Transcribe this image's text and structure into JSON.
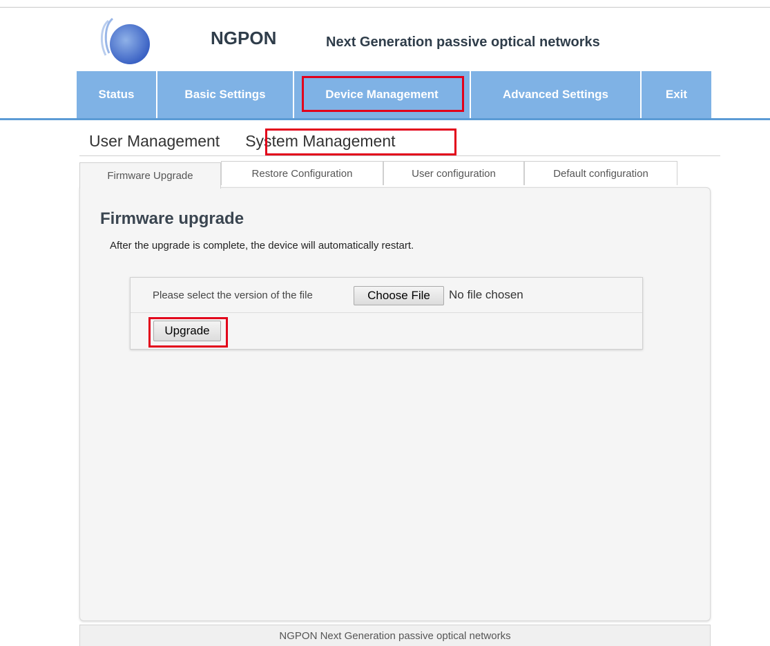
{
  "header": {
    "brand": "NGPON",
    "tagline": "Next Generation passive optical networks",
    "logo_colors": [
      "#6b8fd4",
      "#3b62c4"
    ]
  },
  "nav": {
    "tabs": [
      {
        "label": "Status"
      },
      {
        "label": "Basic Settings"
      },
      {
        "label": "Device Management",
        "highlighted": true
      },
      {
        "label": "Advanced Settings"
      },
      {
        "label": "Exit"
      }
    ],
    "color": "#7fb2e5",
    "highlight_color": "#e2001a"
  },
  "subnav": {
    "items": [
      {
        "label": "User Management"
      },
      {
        "label": "System Management",
        "highlighted": true
      }
    ]
  },
  "tabs": [
    {
      "label": "Firmware Upgrade",
      "active": true
    },
    {
      "label": "Restore Configuration"
    },
    {
      "label": "User configuration"
    },
    {
      "label": "Default configuration"
    }
  ],
  "panel": {
    "title": "Firmware upgrade",
    "description": "After the upgrade is complete, the device will automatically restart.",
    "file_label": "Please select the version of the file",
    "choose_file_label": "Choose File",
    "no_file_text": "No file chosen",
    "upgrade_label": "Upgrade"
  },
  "footer": {
    "text": "NGPON Next Generation passive optical networks"
  }
}
